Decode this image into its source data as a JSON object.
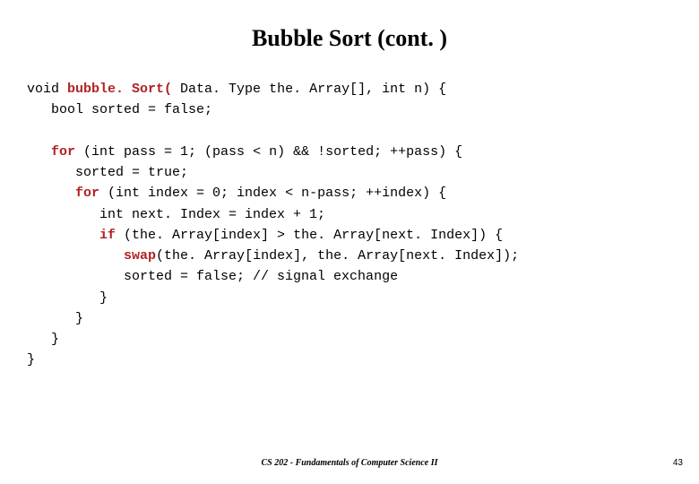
{
  "title": "Bubble Sort (cont. )",
  "code": {
    "l1a": "void ",
    "l1b": "bubble. Sort(",
    "l1c": " Data. Type the. Array[], int n) {",
    "l2": "   bool sorted = false;",
    "l3": "",
    "l4a": "   ",
    "l4b": "for",
    "l4c": " (int pass = 1; (pass < n) && !sorted; ++pass) {",
    "l5": "      sorted = true;",
    "l6a": "      ",
    "l6b": "for",
    "l6c": " (int index = 0; index < n-pass; ++index) {",
    "l7": "         int next. Index = index + 1;",
    "l8a": "         ",
    "l8b": "if",
    "l8c": " (the. Array[index] > the. Array[next. Index]) {",
    "l9a": "            ",
    "l9b": "swap",
    "l9c": "(the. Array[index], the. Array[next. Index]);",
    "l10": "            sorted = false; // signal exchange",
    "l11": "         }",
    "l12": "      }",
    "l13": "   }",
    "l14": "}"
  },
  "footer": "CS 202 - Fundamentals of Computer Science II",
  "pagenum": "43"
}
